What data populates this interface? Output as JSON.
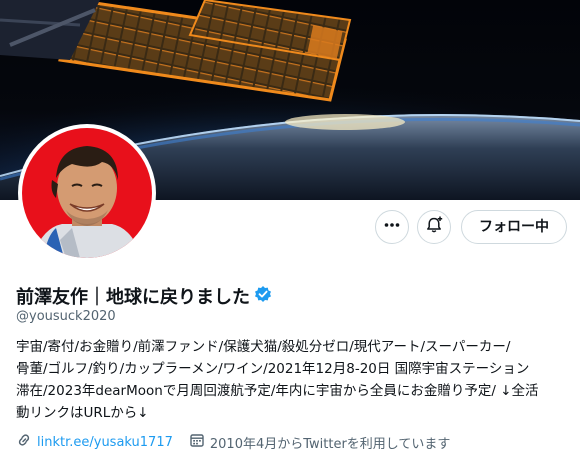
{
  "profile": {
    "display_name": "前澤友作｜地球に戻りました",
    "handle": "@yousuck2020",
    "verified_icon": "verified-badge-icon",
    "bio": [
      "宇宙/寄付/お金贈り/前澤ファンド/保護犬猫/殺処分ゼロ/現代アート/スーパーカー/",
      "骨董/ゴルフ/釣り/カップラーメン/ワイン/2021年12月8-20日 国際宇宙ステーション",
      "滞在/2023年dearMoonで月周回渡航予定/年内に宇宙から全員にお金贈り予定/ ↓全活",
      "動リンクはURLから↓"
    ],
    "link": "linktr.ee/yusaku1717",
    "joined": "2010年4月からTwitterを利用しています"
  },
  "actions": {
    "more_icon": "more-dots-icon",
    "notify_icon": "bell-plus-icon",
    "following_label": "フォロー中"
  },
  "colors": {
    "accent": "#1d9bf0",
    "text": "#0f1419",
    "secondary": "#536471",
    "avatar_bg": "#e8101b"
  }
}
